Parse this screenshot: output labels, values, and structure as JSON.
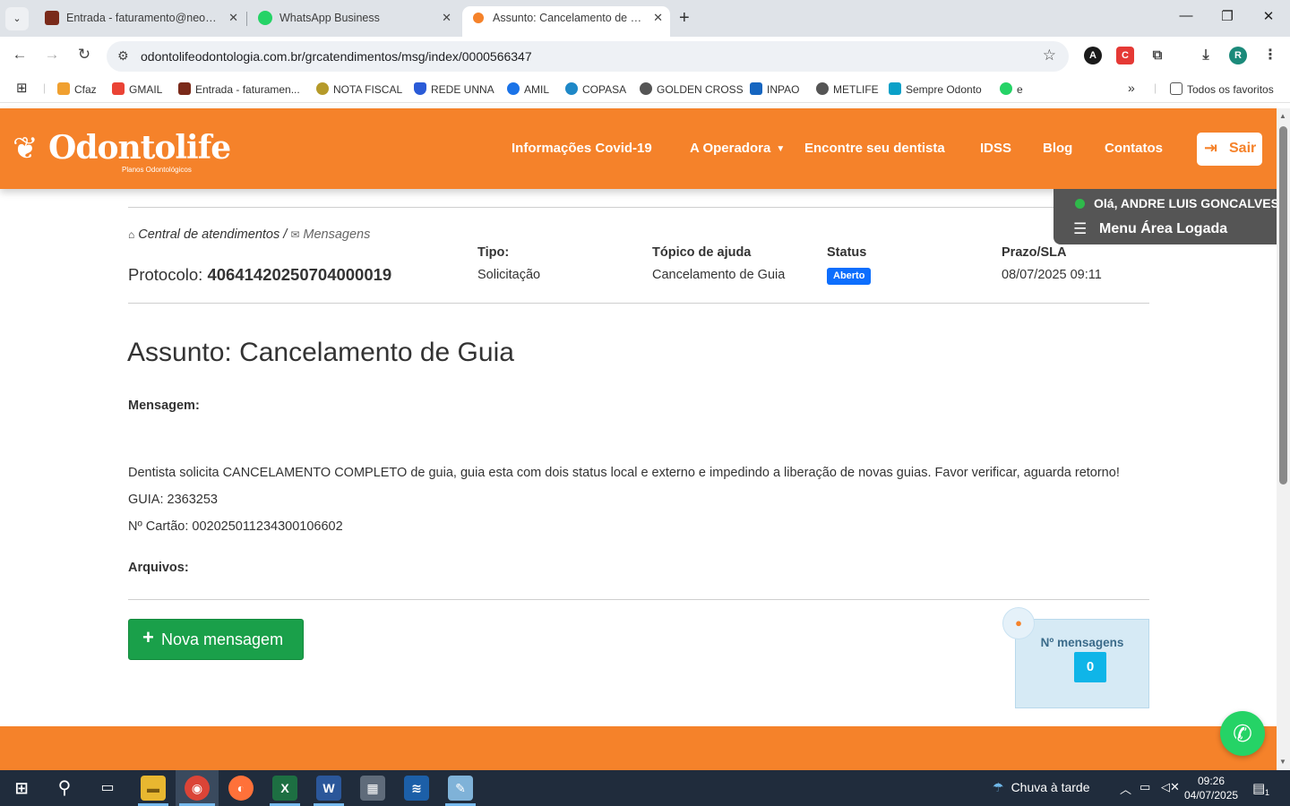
{
  "browser": {
    "tabs": [
      {
        "title": "Entrada - faturamento@neorad",
        "favicon_color": "#7a2a1a",
        "active": false
      },
      {
        "title": "WhatsApp Business",
        "favicon_color": "#25d366",
        "active": false
      },
      {
        "title": "Assunto: Cancelamento de Guia",
        "favicon_color": "#f5822a",
        "active": true
      }
    ],
    "close_glyph": "✕",
    "url": "odontolifeodontologia.com.br/grcatendimentos/msg/index/0000566347",
    "profile_initial": "R"
  },
  "bookmarks": [
    {
      "label": "Cfaz",
      "color": "#f0a030"
    },
    {
      "label": "GMAIL",
      "color": "#ea4335"
    },
    {
      "label": "Entrada - faturamen...",
      "color": "#7a2a1a"
    },
    {
      "label": "NOTA FISCAL",
      "color": "#b59a2a"
    },
    {
      "label": "REDE UNNA",
      "color": "#2a5bd7"
    },
    {
      "label": "AMIL",
      "color": "#1a73e8"
    },
    {
      "label": "COPASA",
      "color": "#1e88c7"
    },
    {
      "label": "GOLDEN CROSS",
      "color": "#555555"
    },
    {
      "label": "INPAO",
      "color": "#1565c0"
    },
    {
      "label": "METLIFE",
      "color": "#555555"
    },
    {
      "label": "Sempre Odonto",
      "color": "#0aa0c8"
    },
    {
      "label": "e",
      "color": "#25d366"
    }
  ],
  "bookmarks_more": "»",
  "bookmarks_all": "Todos os favoritos",
  "site": {
    "logo_text": "Odontolife",
    "logo_sub": "Planos Odontológicos",
    "nav": [
      "Informações Covid-19",
      "A Operadora",
      "Encontre seu dentista",
      "IDSS",
      "Blog",
      "Contatos"
    ],
    "logout": "Sair",
    "greeting": "Olá, ANDRE LUIS GONCALVES",
    "menu_label": "Menu Área Logada",
    "accent": "#f5822a"
  },
  "ticket": {
    "breadcrumb_home": "Central de atendimentos /",
    "breadcrumb_current": "Mensagens",
    "protocolo_label": "Protocolo:",
    "protocolo": "40641420250704000019",
    "tipo_label": "Tipo:",
    "tipo": "Solicitação",
    "topico_label": "Tópico de ajuda",
    "topico": "Cancelamento de Guia",
    "status_label": "Status",
    "status": "Aberto",
    "prazo_label": "Prazo/SLA",
    "prazo": "08/07/2025 09:11",
    "assunto": "Assunto: Cancelamento de Guia",
    "mensagem_label": "Mensagem:",
    "mensagem_lines": [
      "Dentista solicita CANCELAMENTO COMPLETO de guia, guia esta com dois status local e externo e impedindo a liberação de novas guias. Favor verificar, aguarda retorno!",
      "GUIA: 2363253",
      "Nº Cartão: 002025011234300106602"
    ],
    "arquivos_label": "Arquivos:",
    "new_message_button": "Nova mensagem",
    "count_label": "Nº mensagens",
    "count": "0"
  },
  "taskbar": {
    "weather": "Chuva à tarde",
    "time": "09:26",
    "date": "04/07/2025",
    "notif_count": "1"
  }
}
